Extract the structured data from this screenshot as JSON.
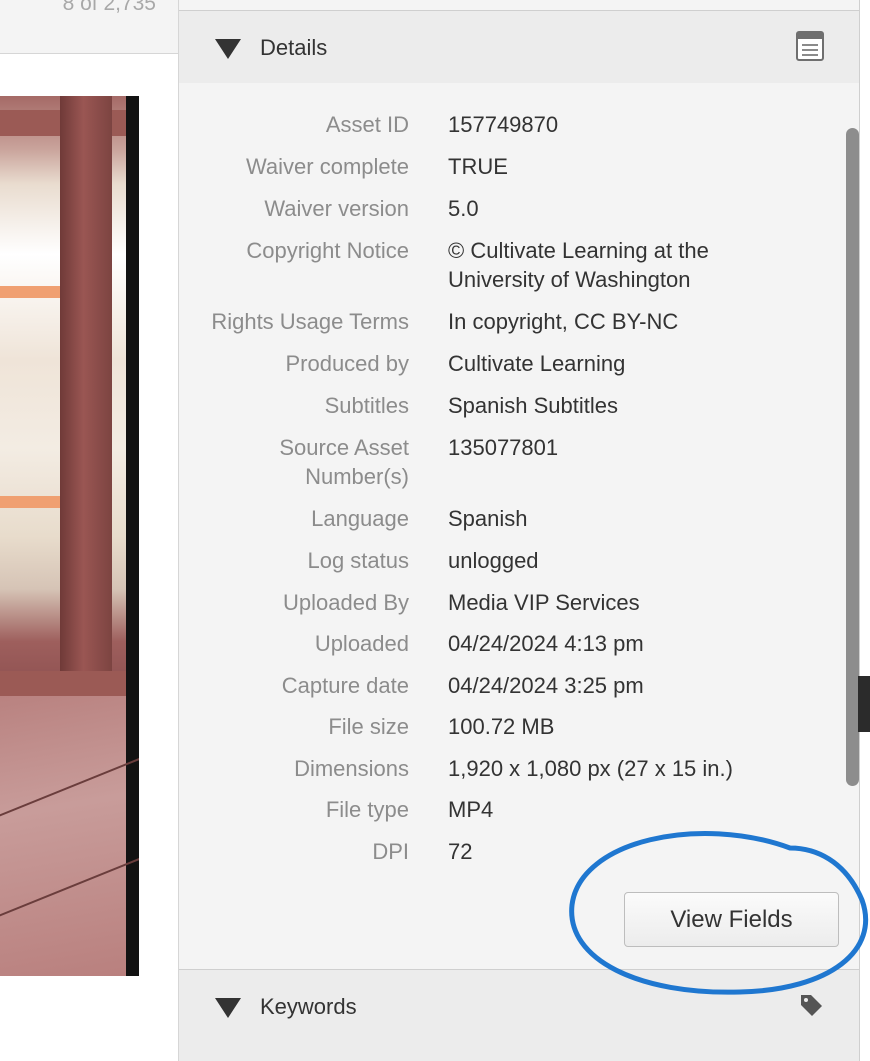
{
  "pager": {
    "counter": "8 of 2,735"
  },
  "details_section": {
    "title": "Details",
    "rows": [
      {
        "label": "Asset ID",
        "value": "157749870"
      },
      {
        "label": "Waiver complete",
        "value": "TRUE"
      },
      {
        "label": "Waiver version",
        "value": "5.0"
      },
      {
        "label": "Copyright Notice",
        "value": "© Cultivate Learning at the University of Washington"
      },
      {
        "label": "Rights Usage Terms",
        "value": "In copyright, CC BY-NC"
      },
      {
        "label": "Produced by",
        "value": "Cultivate Learning"
      },
      {
        "label": "Subtitles",
        "value": "Spanish Subtitles"
      },
      {
        "label": "Source Asset Number(s)",
        "value": "135077801"
      },
      {
        "label": "Language",
        "value": "Spanish"
      },
      {
        "label": "Log status",
        "value": "unlogged"
      },
      {
        "label": "Uploaded By",
        "value": "Media VIP Services"
      },
      {
        "label": "Uploaded",
        "value": "04/24/2024 4:13 pm"
      },
      {
        "label": "Capture date",
        "value": "04/24/2024 3:25 pm"
      },
      {
        "label": "File size",
        "value": "100.72 MB"
      },
      {
        "label": "Dimensions",
        "value": "1,920 x 1,080 px (27 x 15 in.)"
      },
      {
        "label": "File type",
        "value": "MP4"
      },
      {
        "label": "DPI",
        "value": "72"
      }
    ],
    "view_fields_label": "View Fields"
  },
  "keywords_section": {
    "title": "Keywords"
  },
  "icons": {
    "collapse": "triangle-down-icon",
    "details_action": "document-icon",
    "keywords_action": "tag-icon"
  },
  "colors": {
    "panel_bg": "#f4f4f4",
    "label": "#8c8c8c",
    "value": "#333333",
    "annotation_circle": "#1f77d0"
  }
}
